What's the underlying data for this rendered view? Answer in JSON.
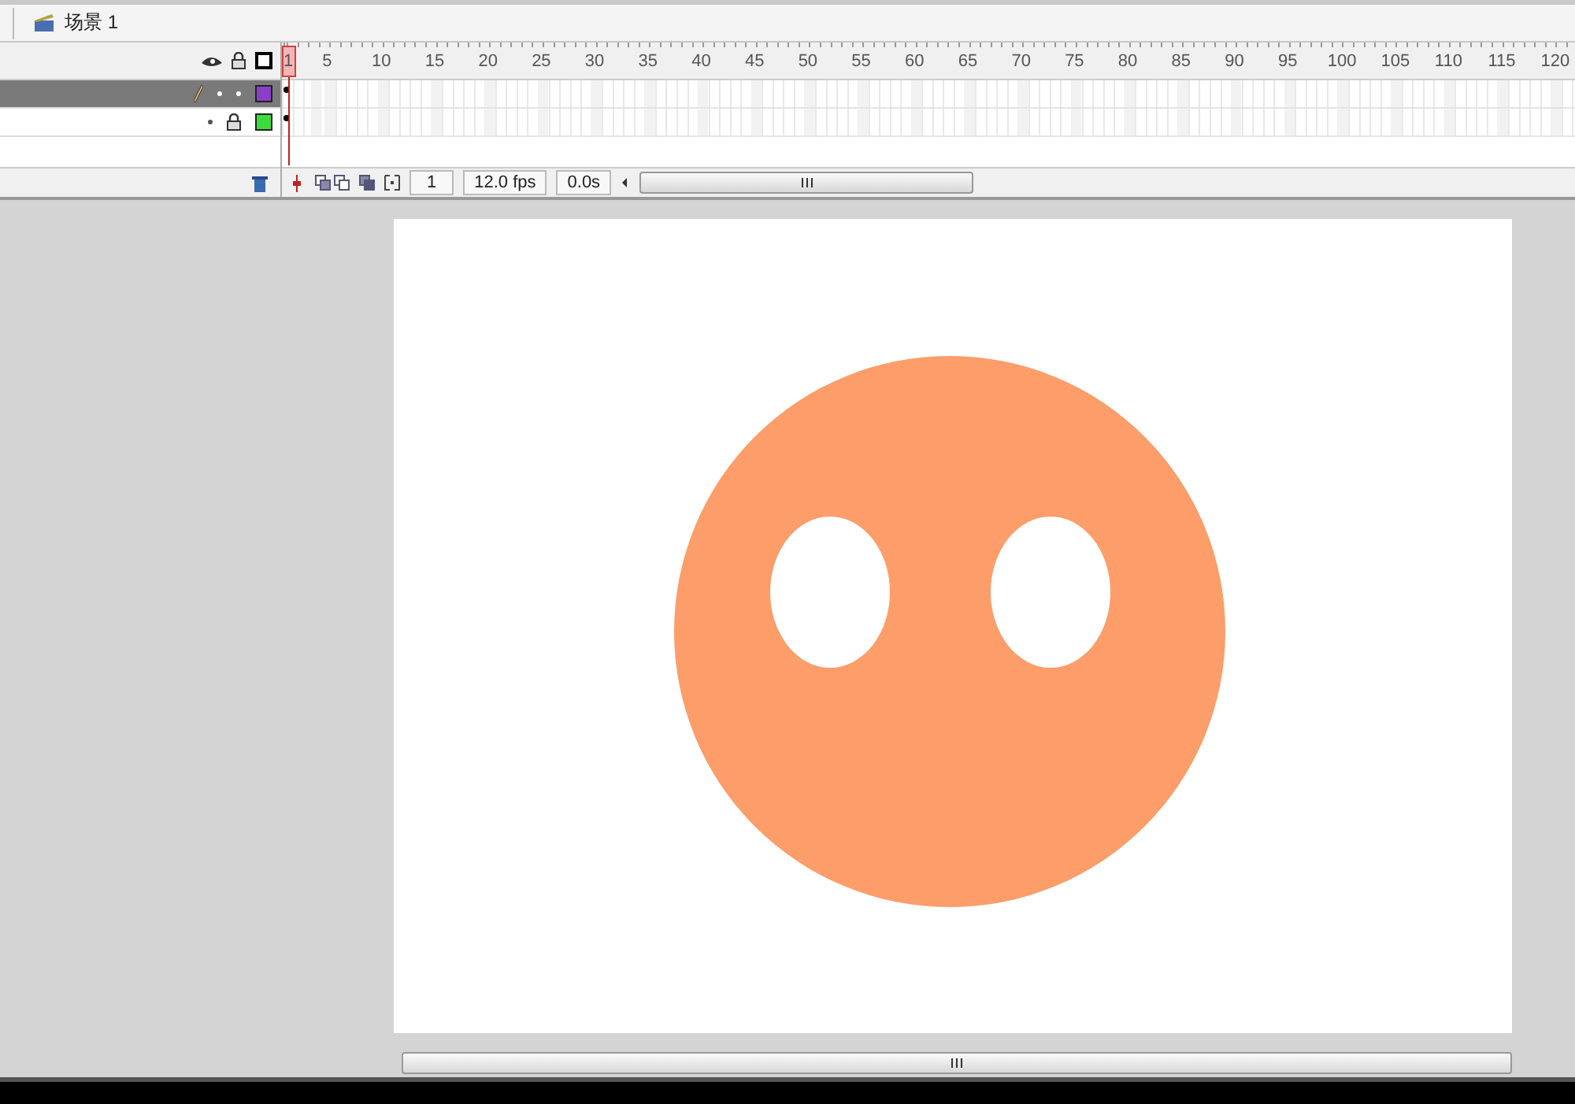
{
  "scene": {
    "title": "场景 1"
  },
  "timeline": {
    "ruler": [
      "1",
      "5",
      "10",
      "15",
      "20",
      "25",
      "30",
      "35",
      "40",
      "45",
      "50",
      "55",
      "60",
      "65",
      "70",
      "75",
      "80",
      "85",
      "90",
      "95",
      "100",
      "105",
      "110",
      "115",
      "120"
    ],
    "layers": [
      {
        "selected": true,
        "editing": true,
        "locked": false,
        "color": "#8a3fc7"
      },
      {
        "selected": false,
        "editing": false,
        "locked": true,
        "color": "#3ddc3d"
      }
    ],
    "current_frame": "1",
    "frame_rate": "12.0 fps",
    "elapsed": "0.0s"
  },
  "stage": {
    "kind": "face"
  }
}
